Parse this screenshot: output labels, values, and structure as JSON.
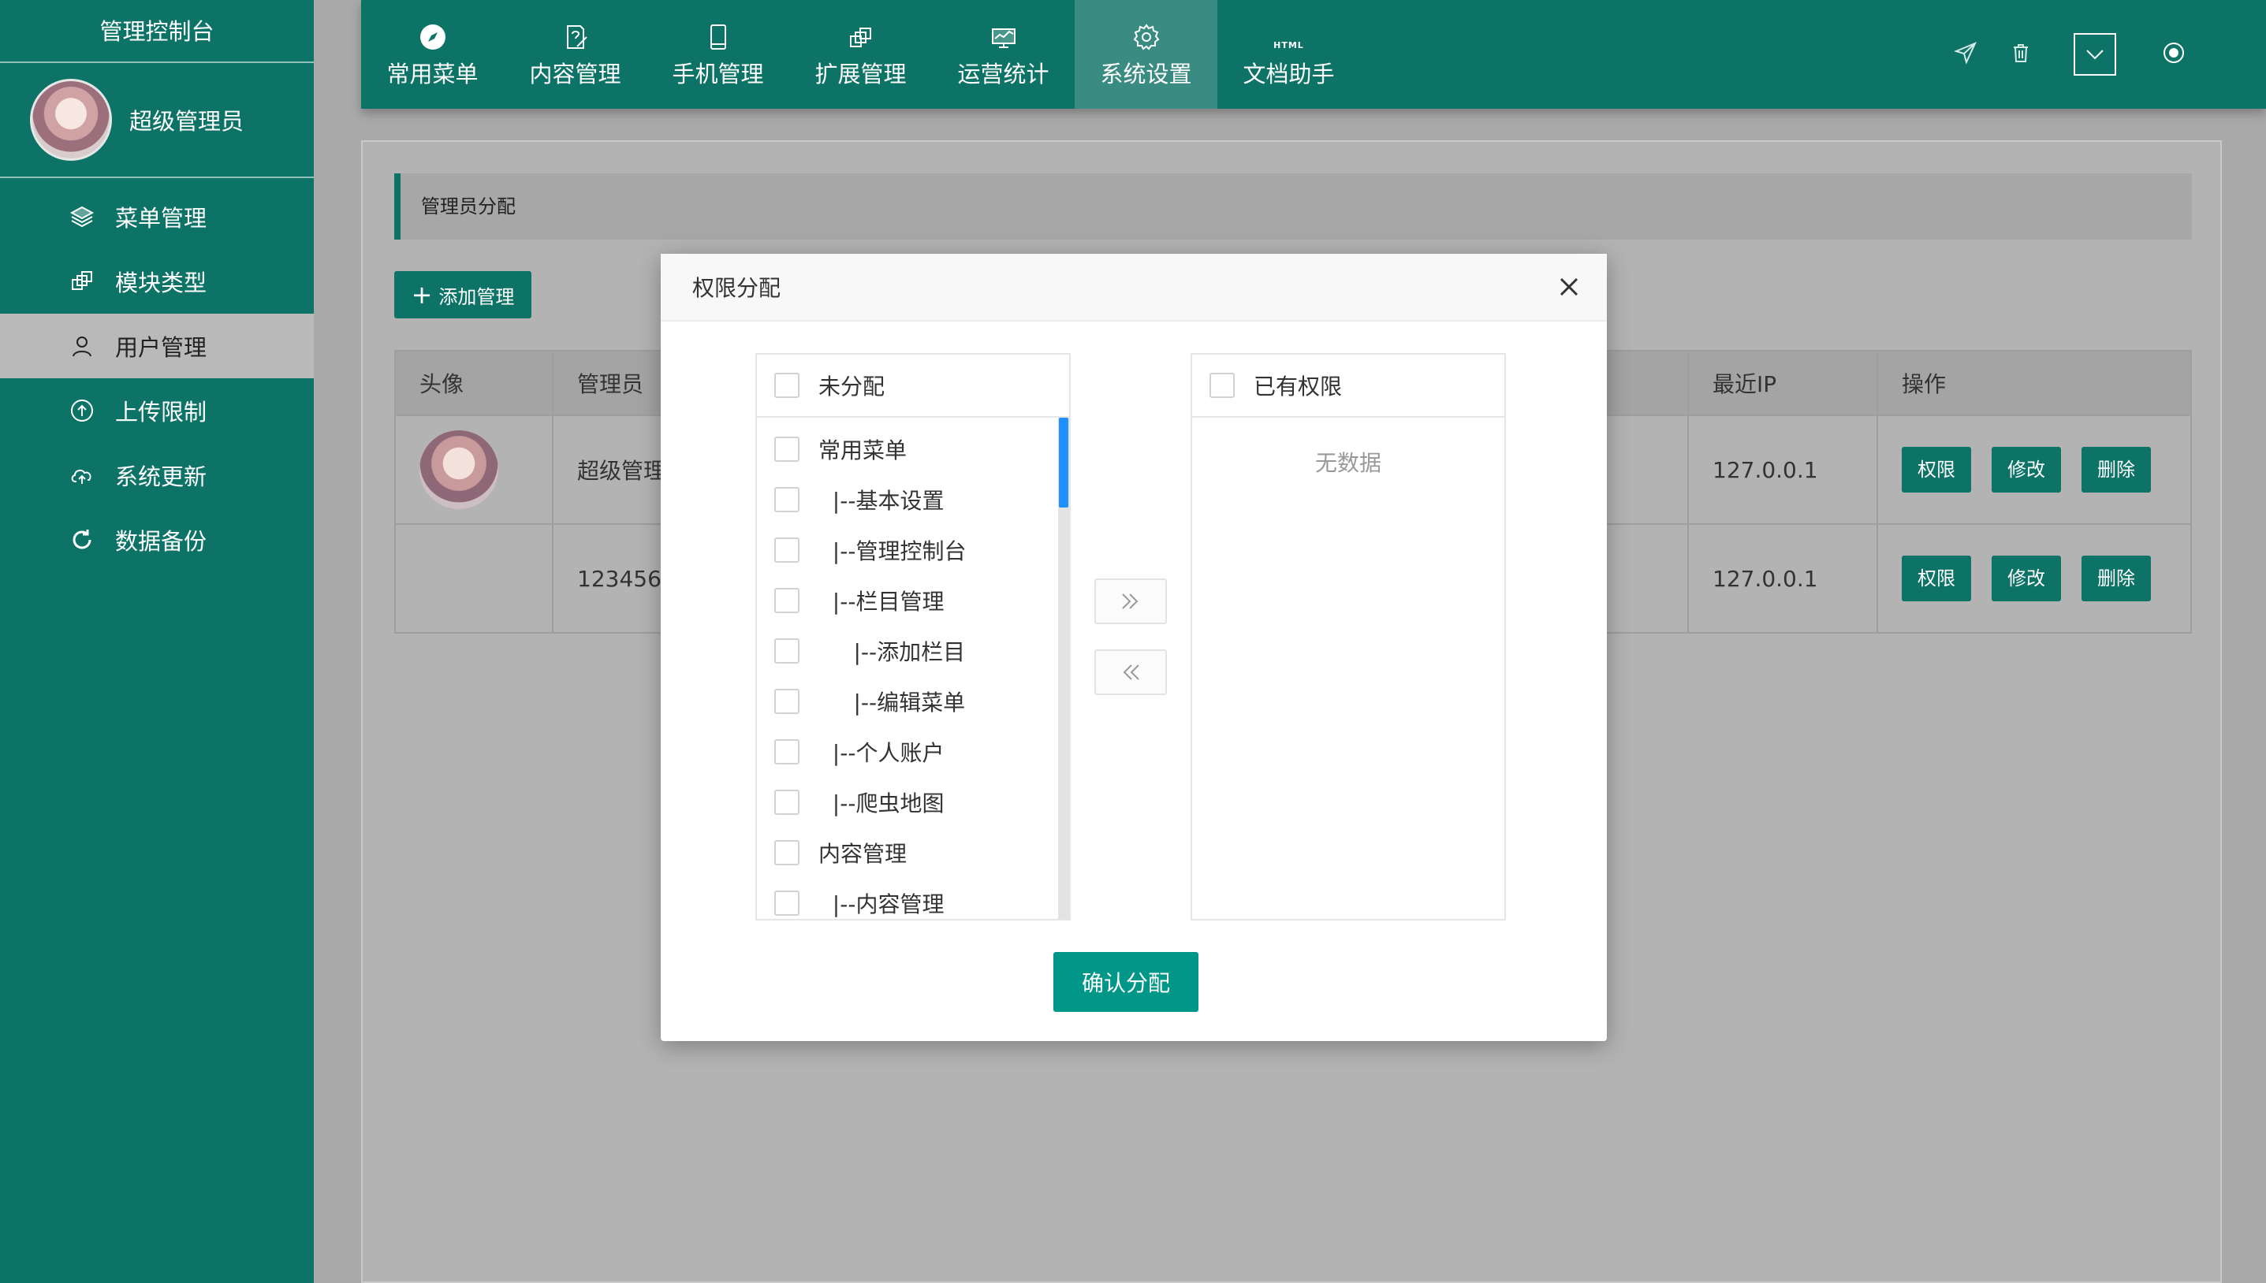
{
  "sidebar": {
    "title": "管理控制台",
    "user_name": "超级管理员",
    "items": [
      {
        "label": "菜单管理",
        "icon": "layers-icon"
      },
      {
        "label": "模块类型",
        "icon": "modules-icon"
      },
      {
        "label": "用户管理",
        "icon": "user-icon",
        "active": true
      },
      {
        "label": "上传限制",
        "icon": "upload-icon"
      },
      {
        "label": "系统更新",
        "icon": "cloud-upload-icon"
      },
      {
        "label": "数据备份",
        "icon": "refresh-icon"
      }
    ]
  },
  "topnav": {
    "items": [
      {
        "label": "常用菜单",
        "icon": "compass-icon"
      },
      {
        "label": "内容管理",
        "icon": "edit-doc-icon"
      },
      {
        "label": "手机管理",
        "icon": "mobile-icon"
      },
      {
        "label": "扩展管理",
        "icon": "extension-icon"
      },
      {
        "label": "运营统计",
        "icon": "chart-icon"
      },
      {
        "label": "系统设置",
        "icon": "gear-icon",
        "active": true
      },
      {
        "label": "文档助手",
        "icon": "html-icon",
        "icon_text": "HTML"
      }
    ],
    "right_icons": [
      "send-icon",
      "trash-icon",
      "dropdown-icon",
      "record-icon"
    ]
  },
  "main": {
    "breadcrumb": "管理员分配",
    "add_button": "添加管理",
    "table": {
      "columns": [
        "头像",
        "管理员",
        "最近IP",
        "操作"
      ],
      "rows": [
        {
          "name": "超级管理",
          "ip": "127.0.0.1",
          "has_avatar": true
        },
        {
          "name": "123456",
          "ip": "127.0.0.1",
          "has_avatar": false
        }
      ],
      "actions": [
        "权限",
        "修改",
        "删除"
      ]
    }
  },
  "modal": {
    "title": "权限分配",
    "left_title": "未分配",
    "right_title": "已有权限",
    "empty_text": "无数据",
    "confirm": "确认分配",
    "left_items": [
      "常用菜单",
      "  |--基本设置",
      "  |--管理控制台",
      "  |--栏目管理",
      "     |--添加栏目",
      "     |--编辑菜单",
      "  |--个人账户",
      "  |--爬虫地图",
      "内容管理",
      "  |--内容管理"
    ]
  },
  "colors": {
    "primary": "#0d7366",
    "confirm": "#009688",
    "scrollbar": "#1e90ff"
  }
}
